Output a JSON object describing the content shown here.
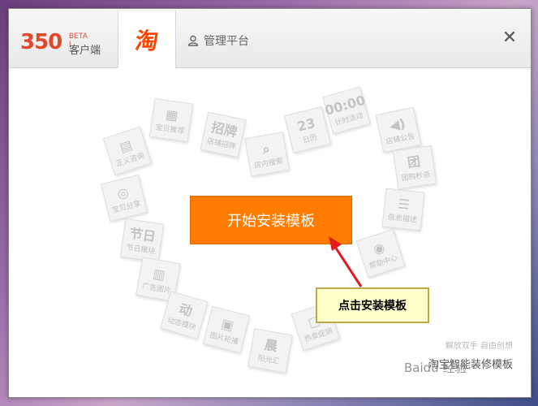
{
  "titlebar": {
    "logo_number": "350",
    "logo_beta": "BETA I",
    "logo_subtitle": "客户端",
    "tab_taobao_glyph": "淘",
    "tab_manage_label": "管理平台",
    "close_glyph": "✕"
  },
  "heart_tiles": [
    {
      "glyph": "▦",
      "label": "宝贝推荐"
    },
    {
      "glyph": "招牌",
      "label": "店铺招牌"
    },
    {
      "glyph": "⌕",
      "label": "店内搜索"
    },
    {
      "glyph": "23",
      "label": "日历"
    },
    {
      "glyph": "00:00",
      "label": "计时活动"
    },
    {
      "glyph": "◀)",
      "label": "店铺公告"
    },
    {
      "glyph": "▤",
      "label": "正义咨询"
    },
    {
      "glyph": "团",
      "label": "团购秒杀"
    },
    {
      "glyph": "◎",
      "label": "宝贝分享"
    },
    {
      "glyph": "☰",
      "label": "信息描述"
    },
    {
      "glyph": "节日",
      "label": "节日模块"
    },
    {
      "glyph": "◉",
      "label": "帮助中心"
    },
    {
      "glyph": "▥",
      "label": "广告图片"
    },
    {
      "glyph": "动",
      "label": "动态模块"
    },
    {
      "glyph": "▣",
      "label": "图片轮播"
    },
    {
      "glyph": "▢",
      "label": "热卖促销"
    },
    {
      "glyph": "晨",
      "label": "阳光汇"
    }
  ],
  "main": {
    "install_button_label": "开始安装模板"
  },
  "annotation": {
    "callout_text": "点击安装模板"
  },
  "slogan": {
    "small": "解放双手  自由创想",
    "main": "淘宝智能装修模板"
  },
  "watermark": {
    "text": "Baidu 经验"
  },
  "colors": {
    "accent": "#ff7c00",
    "taobao_brand": "#ff4400",
    "callout_bg": "#ffffcc",
    "arrow": "#e21b1b"
  }
}
